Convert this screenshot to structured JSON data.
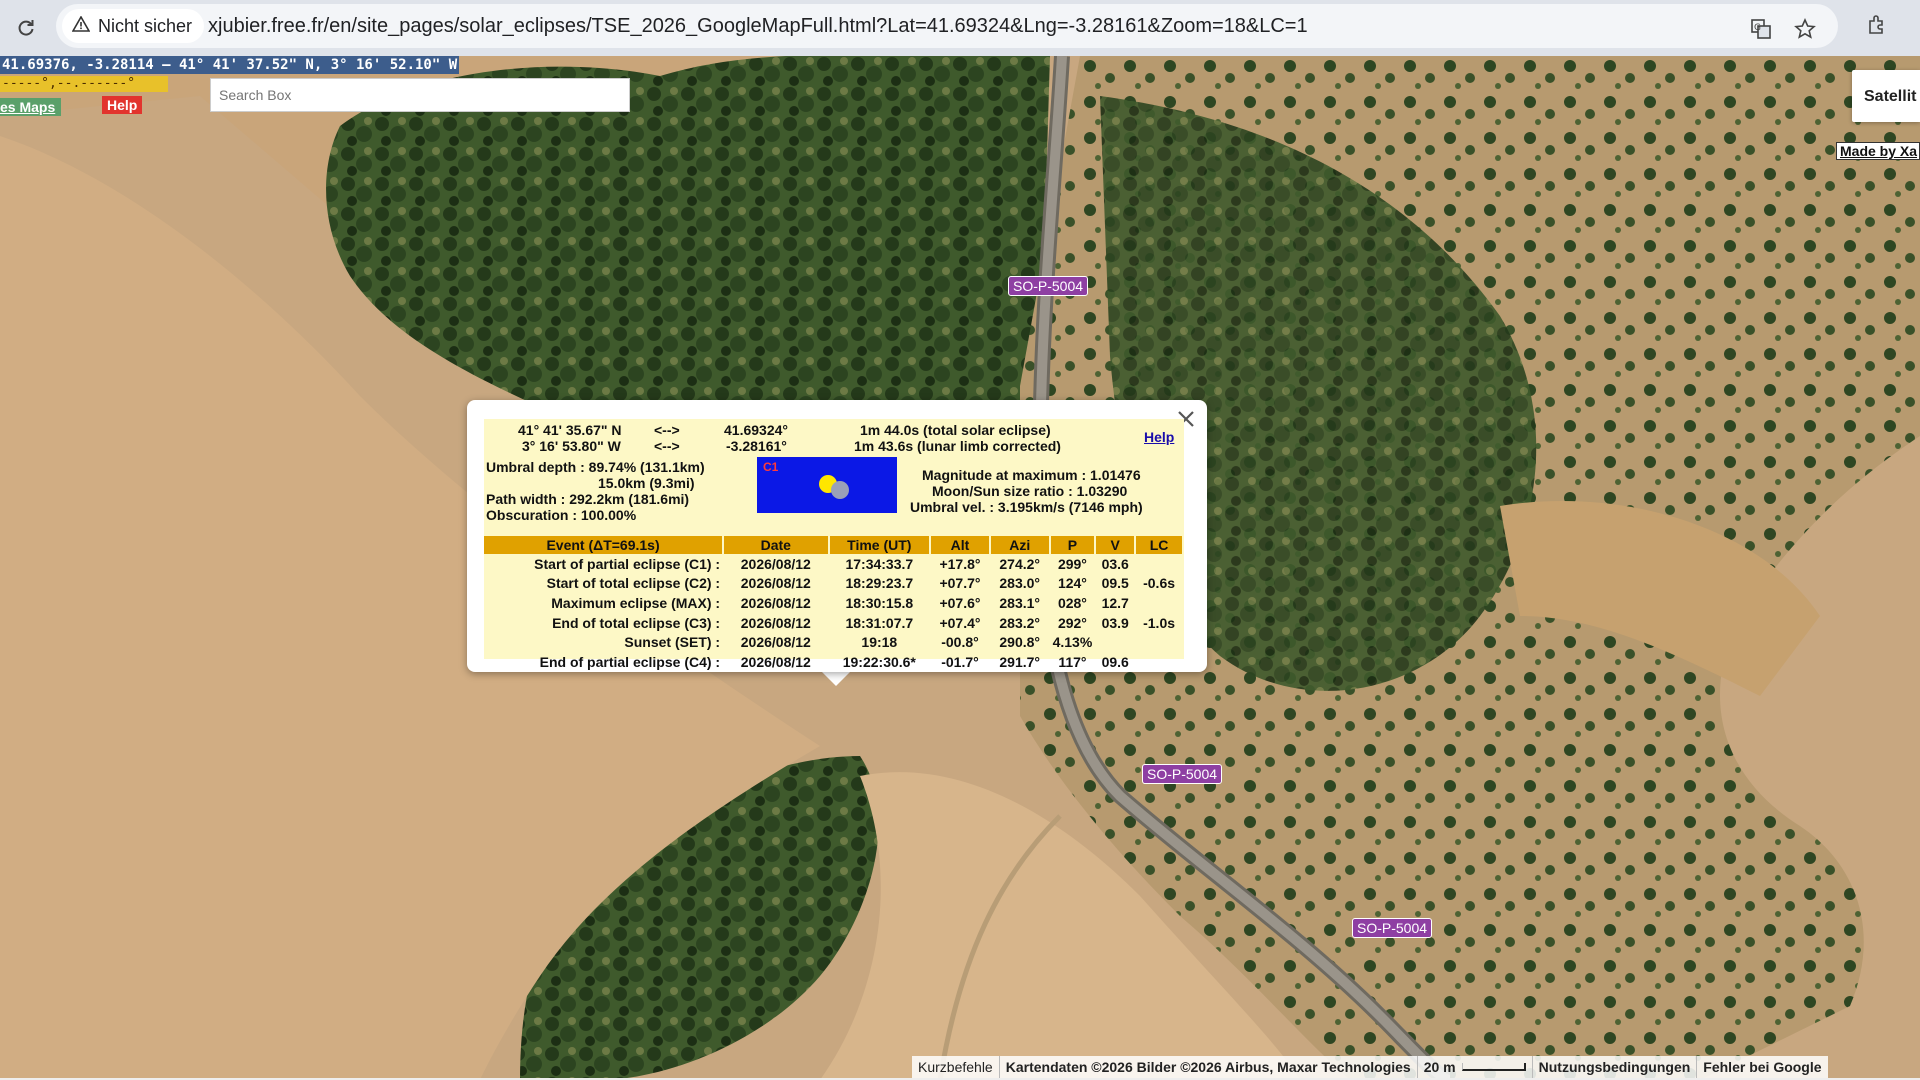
{
  "browser": {
    "security_label": "Nicht sicher",
    "url": "xjubier.free.fr/en/site_pages/solar_eclipses/TSE_2026_GoogleMapFull.html?Lat=41.69324&Lng=-3.28161&Zoom=18&LC=1"
  },
  "map": {
    "coord_readout": "41.69376, -3.28114 — 41° 41' 37.52\" N, 3° 16' 52.10\" W",
    "dashes": "-----°,--.------°",
    "maps_link": "es Maps",
    "help_label": "Help",
    "search_placeholder": "Search Box",
    "map_type_label": "Satellit",
    "made_by": "Made by Xa",
    "road_labels": [
      "SO-P-5004",
      "SO-P-5004",
      "SO-P-5004"
    ]
  },
  "info": {
    "lat_dms": "41° 41' 35.67\" N",
    "lon_dms": "3° 16' 53.80\" W",
    "arrow": "<-->",
    "lat_dec": "41.69324°",
    "lon_dec": "-3.28161°",
    "duration_total": "1m 44.0s (total solar eclipse)",
    "duration_limb": "1m 43.6s (lunar limb corrected)",
    "help_link": "Help",
    "umbral_depth": "Umbral depth : 89.74% (131.1km)",
    "umbral_depth2": "15.0km (9.3mi)",
    "path_width": "Path width : 292.2km (181.6mi)",
    "obscuration": "Obscuration : 100.00%",
    "c1_label": "C1",
    "magnitude": "Magnitude at maximum : 1.01476",
    "ratio": "Moon/Sun size ratio : 1.03290",
    "umbral_vel": "Umbral vel. : 3.195km/s (7146 mph)",
    "table": {
      "headers": [
        "Event (ΔT=69.1s)",
        "Date",
        "Time (UT)",
        "Alt",
        "Azi",
        "P",
        "V",
        "LC"
      ],
      "rows": [
        [
          "Start of partial eclipse (C1) :",
          "2026/08/12",
          "17:34:33.7",
          "+17.8°",
          "274.2°",
          "299°",
          "03.6",
          ""
        ],
        [
          "Start of total eclipse (C2) :",
          "2026/08/12",
          "18:29:23.7",
          "+07.7°",
          "283.0°",
          "124°",
          "09.5",
          "-0.6s"
        ],
        [
          "Maximum eclipse (MAX) :",
          "2026/08/12",
          "18:30:15.8",
          "+07.6°",
          "283.1°",
          "028°",
          "12.7",
          ""
        ],
        [
          "End of total eclipse (C3) :",
          "2026/08/12",
          "18:31:07.7",
          "+07.4°",
          "283.2°",
          "292°",
          "03.9",
          "-1.0s"
        ],
        [
          "Sunset (SET) :",
          "2026/08/12",
          "19:18",
          "-00.8°",
          "290.8°",
          "4.13%",
          "",
          ""
        ],
        [
          "End of partial eclipse (C4) :",
          "2026/08/12",
          "19:22:30.6*",
          "-01.7°",
          "291.7°",
          "117°",
          "09.6",
          ""
        ]
      ]
    }
  },
  "attribution": {
    "shortcuts": "Kurzbefehle",
    "map_data": "Kartendaten ©2026 Bilder ©2026 Airbus, Maxar Technologies",
    "scale": "20 m",
    "terms": "Nutzungsbedingungen",
    "report": "Fehler bei Google"
  }
}
